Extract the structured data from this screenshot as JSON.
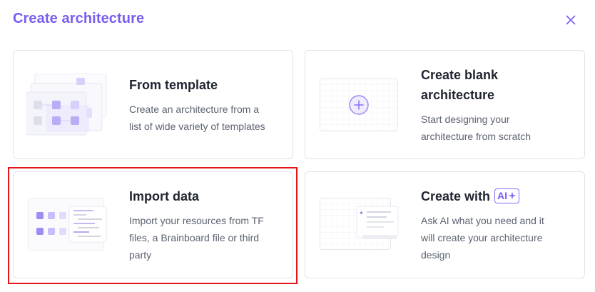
{
  "dialog": {
    "title": "Create architecture",
    "close_icon": "close-icon"
  },
  "cards": [
    {
      "id": "from-template",
      "title": "From template",
      "description_lines": [
        "Create an architecture from a",
        "list of wide variety of templates"
      ]
    },
    {
      "id": "blank",
      "title_lines": [
        "Create blank",
        "architecture"
      ],
      "description_lines": [
        "Start designing your",
        "architecture from scratch"
      ]
    },
    {
      "id": "import",
      "title": "Import data",
      "description_lines": [
        "Import your resources from TF",
        "files, a Brainboard file or third",
        "party"
      ]
    },
    {
      "id": "ai",
      "title": "Create with",
      "badge": "AI",
      "description_lines": [
        "Ask AI what you need and it",
        "will create your architecture",
        "design"
      ]
    }
  ],
  "colors": {
    "accent": "#7b5cf0",
    "highlight": "#e5141a",
    "title": "#1f2430",
    "text": "#5b6270",
    "border": "#e1e3e8"
  }
}
